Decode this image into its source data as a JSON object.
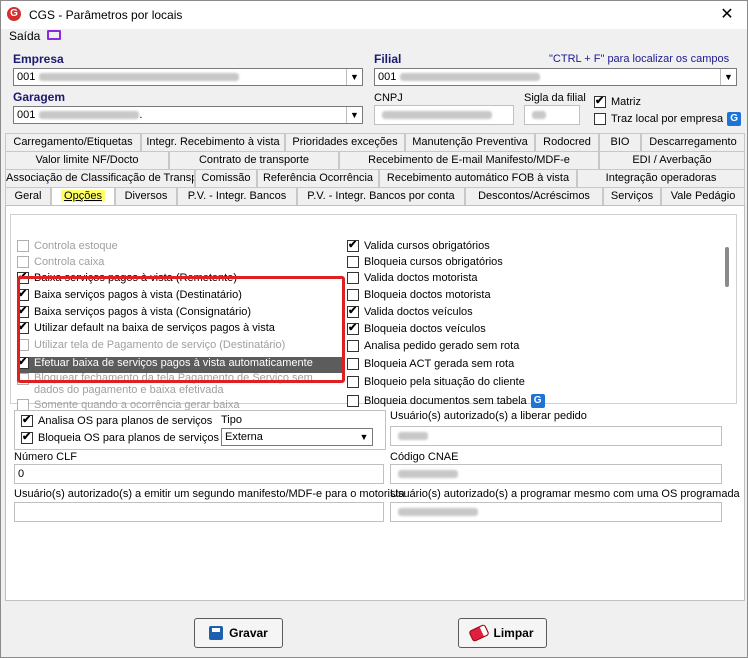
{
  "window": {
    "title": "CGS - Parâmetros por locais",
    "close": "✕"
  },
  "menu": {
    "saida": "Saída"
  },
  "header": {
    "empresa_label": "Empresa",
    "empresa_value": "001",
    "filial_label": "Filial",
    "filial_value": "001",
    "hint": "\"CTRL + F\" para localizar os campos",
    "garagem_label": "Garagem",
    "garagem_value": "001",
    "garagem_suffix": ".",
    "cnpj_label": "CNPJ",
    "sigla_label": "Sigla da filial",
    "matriz_label": "Matriz",
    "traz_local_label": "Traz local por empresa"
  },
  "tabs": {
    "row1": [
      "Carregamento/Etiquetas",
      "Integr. Recebimento à vista",
      "Prioridades exceções",
      "Manutenção Preventiva",
      "Rodocred",
      "BIO",
      "Descarregamento"
    ],
    "row2": [
      "Valor limite NF/Docto",
      "Contrato de transporte",
      "Recebimento de E-mail Manifesto/MDF-e",
      "EDI / Averbação"
    ],
    "row3": [
      "Associação de Classificação de Transporte",
      "Comissão",
      "Referência Ocorrência",
      "Recebimento automático FOB à vista",
      "Integração operadoras"
    ],
    "row4": [
      "Geral",
      "Opções",
      "Diversos",
      "P.V. - Integr. Bancos",
      "P.V. - Integr. Bancos por conta",
      "Descontos/Acréscimos",
      "Serviços",
      "Vale Pedágio"
    ]
  },
  "options_left": [
    {
      "label": "Controla estoque",
      "checked": false,
      "disabled": true
    },
    {
      "label": "Controla caixa",
      "checked": false,
      "disabled": true
    },
    {
      "label": "Baixa serviços pagos à vista (Remetente)",
      "checked": true,
      "disabled": false
    },
    {
      "label": "Baixa serviços pagos à vista (Destinatário)",
      "checked": true,
      "disabled": false
    },
    {
      "label": "Baixa serviços pagos à vista (Consignatário)",
      "checked": true,
      "disabled": false
    },
    {
      "label": "Utilizar default na baixa de serviços pagos à vista",
      "checked": true,
      "disabled": false
    },
    {
      "label": "Utilizar tela de Pagamento de serviço (Destinatário)",
      "checked": false,
      "disabled": true
    },
    {
      "label": "Efetuar baixa de serviços pagos à vista automaticamente",
      "checked": true,
      "disabled": false
    },
    {
      "label": "Bloquear fechamento da tela Pagamento de Serviço sem",
      "label2": "dados do pagamento e baixa efetivada",
      "checked": false,
      "disabled": true
    },
    {
      "label": "Somente quando a ocorrência gerar baixa",
      "checked": false,
      "disabled": true
    }
  ],
  "options_right": [
    {
      "label": "Valida cursos obrigatórios",
      "checked": true
    },
    {
      "label": "Bloqueia cursos obrigatórios",
      "checked": false
    },
    {
      "label": "Valida doctos motorista",
      "checked": false
    },
    {
      "label": "Bloqueia doctos motorista",
      "checked": false
    },
    {
      "label": "Valida doctos veículos",
      "checked": true
    },
    {
      "label": "Bloqueia doctos veículos",
      "checked": true
    },
    {
      "label": "Analisa pedido gerado sem rota",
      "checked": false
    },
    {
      "label": "Bloqueia ACT gerada sem rota",
      "checked": false
    },
    {
      "label": "Bloqueio pela situação do cliente",
      "checked": false
    },
    {
      "label": "Bloqueia documentos sem tabela",
      "checked": false
    }
  ],
  "lower": {
    "analisa_os": "Analisa OS para planos de serviços",
    "bloqueia_os": "Bloqueia OS para planos de serviços",
    "tipo_label": "Tipo",
    "tipo_value": "Externa",
    "usuarios_liberar_label": "Usuário(s) autorizado(s) a liberar pedido",
    "numero_clf_label": "Número CLF",
    "numero_clf_value": "0",
    "codigo_cnae_label": "Código CNAE",
    "segundo_manifesto_label": "Usuário(s) autorizado(s) a emitir um segundo manifesto/MDF-e para o motorista",
    "programar_os_label": "Usuário(s) autorizado(s) a programar mesmo com uma OS programada"
  },
  "buttons": {
    "gravar": "Gravar",
    "limpar": "Limpar"
  }
}
